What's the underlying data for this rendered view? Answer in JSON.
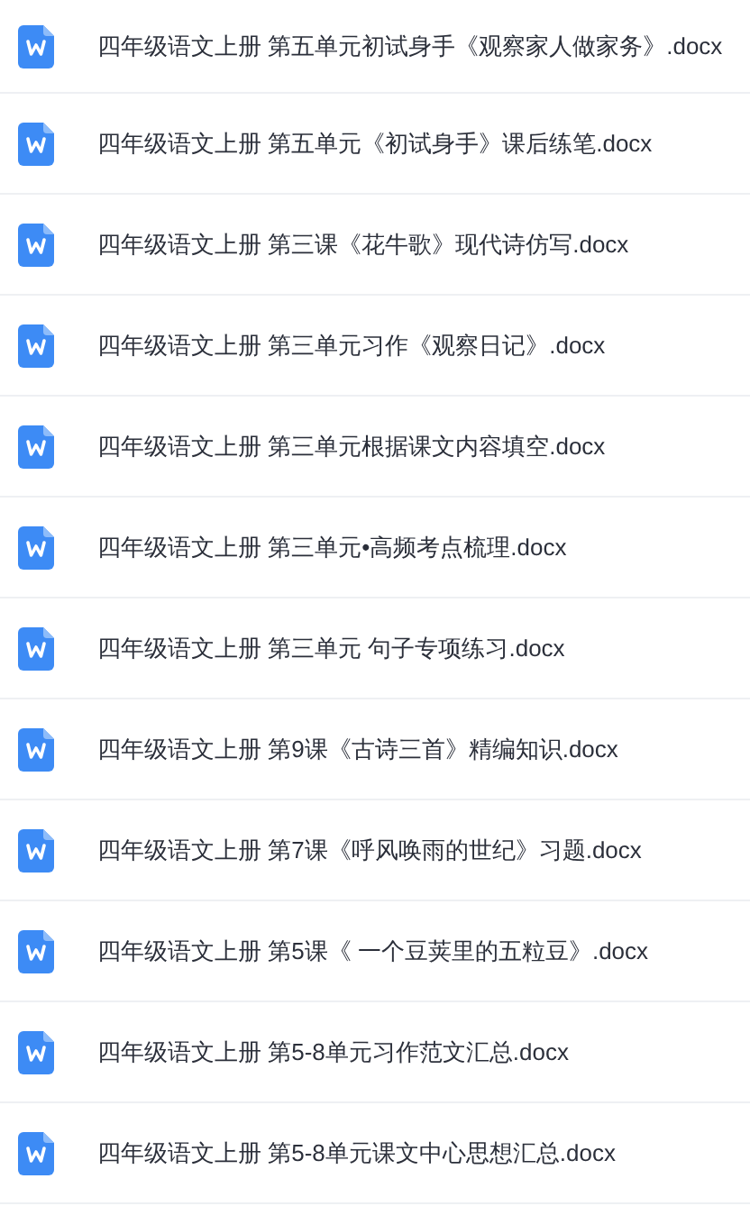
{
  "files": [
    {
      "name": "四年级语文上册 第五单元初试身手《观察家人做家务》.docx"
    },
    {
      "name": "四年级语文上册 第五单元《初试身手》课后练笔.docx"
    },
    {
      "name": "四年级语文上册 第三课《花牛歌》现代诗仿写.docx"
    },
    {
      "name": "四年级语文上册 第三单元习作《观察日记》.docx"
    },
    {
      "name": "四年级语文上册 第三单元根据课文内容填空.docx"
    },
    {
      "name": "四年级语文上册 第三单元•高频考点梳理.docx"
    },
    {
      "name": "四年级语文上册 第三单元 句子专项练习.docx"
    },
    {
      "name": "四年级语文上册 第9课《古诗三首》精编知识.docx"
    },
    {
      "name": "四年级语文上册 第7课《呼风唤雨的世纪》习题.docx"
    },
    {
      "name": "四年级语文上册 第5课《 一个豆荚里的五粒豆》.docx"
    },
    {
      "name": "四年级语文上册 第5-8单元习作范文汇总.docx"
    },
    {
      "name": "四年级语文上册 第5-8单元课文中心思想汇总.docx"
    }
  ]
}
